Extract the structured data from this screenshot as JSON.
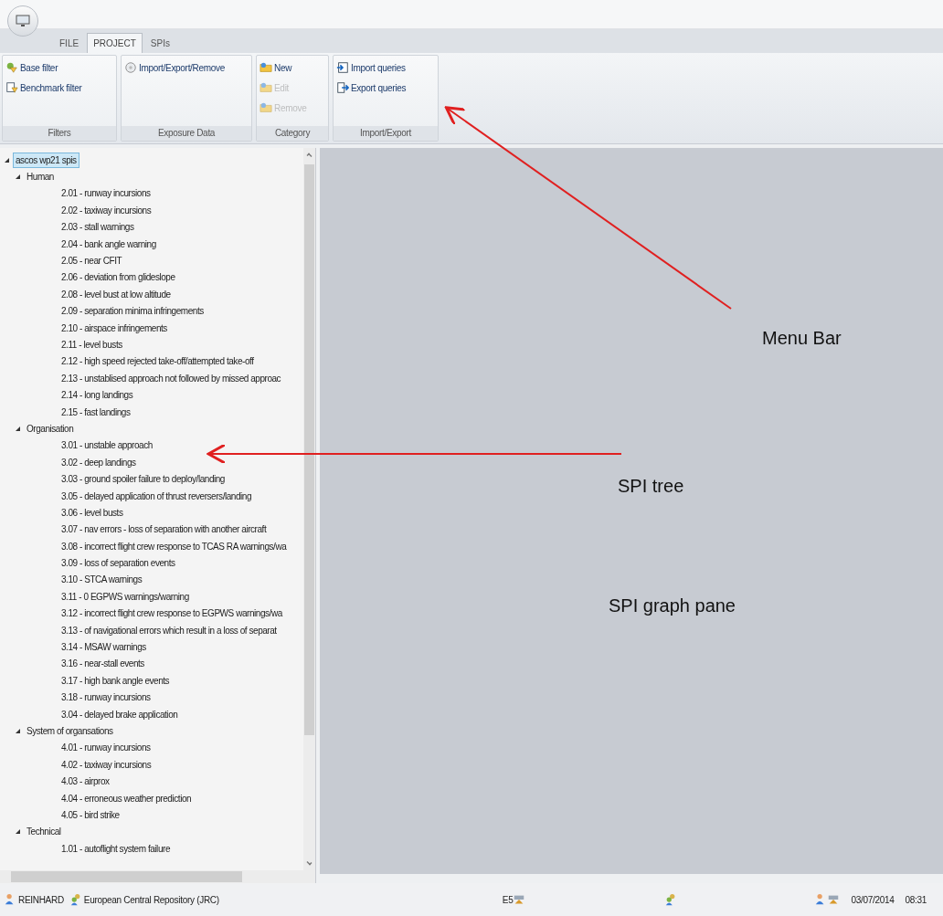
{
  "tabs": [
    {
      "label": "FILE",
      "selected": false
    },
    {
      "label": "PROJECT",
      "selected": true
    },
    {
      "label": "SPIs",
      "selected": false
    }
  ],
  "ribbon_groups": [
    {
      "label": "Filters",
      "items": [
        {
          "label": "Base filter",
          "kind": "filter",
          "disabled": false
        },
        {
          "label": "Benchmark filter",
          "kind": "benchmark",
          "disabled": false
        }
      ]
    },
    {
      "label": "Exposure Data",
      "items": [
        {
          "label": "Import/Export/Remove",
          "kind": "disk",
          "disabled": false
        }
      ]
    },
    {
      "label": "Category",
      "items": [
        {
          "label": "New",
          "kind": "folder",
          "disabled": false
        },
        {
          "label": "Edit",
          "kind": "folder",
          "disabled": true
        },
        {
          "label": "Remove",
          "kind": "folder",
          "disabled": true
        }
      ]
    },
    {
      "label": "Import/Export",
      "items": [
        {
          "label": "Import queries",
          "kind": "import",
          "disabled": false
        },
        {
          "label": "Export queries",
          "kind": "export",
          "disabled": false
        }
      ]
    }
  ],
  "tree": {
    "label": "ascos wp21 spis",
    "selected": true,
    "expanded": true,
    "children": [
      {
        "label": "Human",
        "selected": false,
        "expanded": true,
        "children": [
          {
            "label": "2.01 - runway incursions",
            "selected": false
          },
          {
            "label": "2.02 - taxiway incursions",
            "selected": false
          },
          {
            "label": "2.03 - stall warnings",
            "selected": false
          },
          {
            "label": "2.04 - bank angle warning",
            "selected": false
          },
          {
            "label": "2.05 - near CFIT",
            "selected": false
          },
          {
            "label": "2.06 - deviation from glideslope",
            "selected": false
          },
          {
            "label": "2.08 - level bust at low altitude",
            "selected": false
          },
          {
            "label": "2.09 - separation minima infringements",
            "selected": false
          },
          {
            "label": "2.10 - airspace infringements",
            "selected": false
          },
          {
            "label": "2.11 - level busts",
            "selected": false
          },
          {
            "label": "2.12 - high speed rejected take-off/attempted take-off",
            "selected": false
          },
          {
            "label": "2.13 - unstablised approach not followed by missed approac",
            "selected": false
          },
          {
            "label": "2.14 - long landings",
            "selected": false
          },
          {
            "label": "2.15 - fast landings",
            "selected": false
          }
        ]
      },
      {
        "label": "Organisation",
        "selected": false,
        "expanded": true,
        "children": [
          {
            "label": "3.01 - unstable approach",
            "selected": false
          },
          {
            "label": "3.02 - deep landings",
            "selected": false
          },
          {
            "label": "3.03 - ground spoiler failure to deploy/landing",
            "selected": false
          },
          {
            "label": "3.05 - delayed application of thrust reversers/landing",
            "selected": false
          },
          {
            "label": "3.06 - level busts",
            "selected": false
          },
          {
            "label": "3.07 - nav errors -  loss of separation with another aircraft",
            "selected": false
          },
          {
            "label": "3.08 - incorrect flight crew response to TCAS RA warnings/wa",
            "selected": false
          },
          {
            "label": "3.09 - loss of separation events",
            "selected": false
          },
          {
            "label": "3.10 - STCA warnings",
            "selected": false
          },
          {
            "label": "3.11 - 0 EGPWS warnings/warning",
            "selected": false
          },
          {
            "label": "3.12 - incorrect flight crew response to EGPWS warnings/wa",
            "selected": false
          },
          {
            "label": "3.13 -  of navigational errors which result in a loss of separat",
            "selected": false
          },
          {
            "label": "3.14 - MSAW warnings",
            "selected": false
          },
          {
            "label": "3.16 - near-stall events",
            "selected": false
          },
          {
            "label": "3.17 - high bank angle events",
            "selected": false
          },
          {
            "label": "3.18 - runway incursions",
            "selected": false
          },
          {
            "label": "3.04 - delayed brake application",
            "selected": false
          }
        ]
      },
      {
        "label": "System of organsations",
        "selected": false,
        "expanded": true,
        "children": [
          {
            "label": "4.01 - runway incursions",
            "selected": false
          },
          {
            "label": "4.02 - taxiway incursions",
            "selected": false
          },
          {
            "label": "4.03 - airprox",
            "selected": false
          },
          {
            "label": "4.04 - erroneous weather prediction",
            "selected": false
          },
          {
            "label": "4.05 - bird strike",
            "selected": false
          }
        ]
      },
      {
        "label": "Technical",
        "selected": false,
        "expanded": true,
        "children": [
          {
            "label": "1.01 - autoflight system failure",
            "selected": false
          }
        ]
      }
    ]
  },
  "annotations": [
    {
      "label": "Menu Bar"
    },
    {
      "label": "SPI tree"
    },
    {
      "label": "SPI graph pane"
    }
  ],
  "status_bar": {
    "user": "REINHARD",
    "repository": "European Central Repository (JRC)",
    "code": "E5",
    "date": "03/07/2014",
    "time": "08:31"
  }
}
